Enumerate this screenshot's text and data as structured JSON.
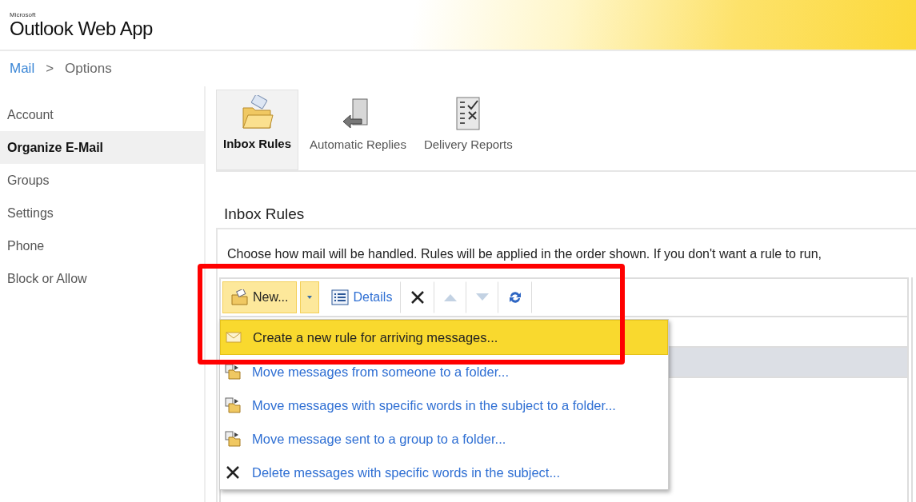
{
  "header": {
    "brand_small": "Microsoft",
    "brand": "Outlook Web App"
  },
  "breadcrumb": [
    {
      "label": "Mail",
      "kind": "link"
    },
    {
      "label": ">",
      "kind": "separator"
    },
    {
      "label": "Options",
      "kind": "current"
    }
  ],
  "sidebar": {
    "items": [
      {
        "label": "Account",
        "selected": false
      },
      {
        "label": "Organize E-Mail",
        "selected": true
      },
      {
        "label": "Groups",
        "selected": false
      },
      {
        "label": "Settings",
        "selected": false
      },
      {
        "label": "Phone",
        "selected": false
      },
      {
        "label": "Block or Allow",
        "selected": false
      }
    ]
  },
  "tabs": [
    {
      "label": "Inbox Rules",
      "kind": "folder",
      "selected": true
    },
    {
      "label": "Automatic Replies",
      "kind": "door",
      "selected": false
    },
    {
      "label": "Delivery Reports",
      "kind": "checklist",
      "selected": false
    }
  ],
  "section_title": "Inbox Rules",
  "description": "Choose how mail will be handled. Rules will be applied in the order shown. If you don't want a rule to run,",
  "toolbar": [
    {
      "kind": "new",
      "label": "New...",
      "active": true,
      "disabled": false
    },
    {
      "kind": "dropdown",
      "active": true,
      "disabled": false
    },
    {
      "kind": "details",
      "label": "Details",
      "active": false,
      "disabled": false
    },
    {
      "kind": "delete",
      "active": false,
      "disabled": false
    },
    {
      "kind": "up",
      "active": false,
      "disabled": true
    },
    {
      "kind": "down",
      "active": false,
      "disabled": true
    },
    {
      "kind": "refresh",
      "active": false,
      "disabled": false
    }
  ],
  "rule_rows": [
    {
      "selected": false
    },
    {
      "selected": true
    }
  ],
  "menu": {
    "items": [
      {
        "label": "Create a new rule for arriving messages...",
        "kind": "mail",
        "highlighted": true
      },
      {
        "label": "Move messages from someone to a folder...",
        "kind": "move",
        "highlighted": false
      },
      {
        "label": "Move messages with specific words in the subject to a folder...",
        "kind": "move",
        "highlighted": false
      },
      {
        "label": "Move message sent to a group to a folder...",
        "kind": "move",
        "highlighted": false
      },
      {
        "label": "Delete messages with specific words in the subject...",
        "kind": "delete",
        "highlighted": false
      }
    ]
  }
}
